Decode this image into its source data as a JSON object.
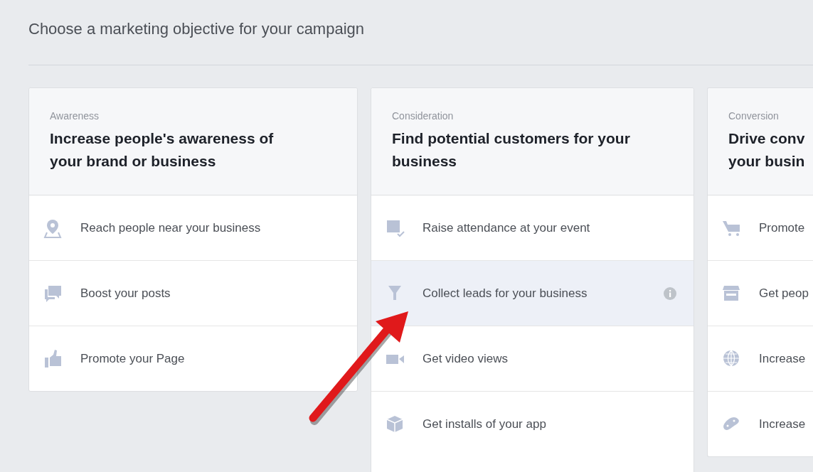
{
  "title": "Choose a marketing objective for your campaign",
  "objectives": [
    {
      "category": "Awareness",
      "heading_lines": [
        "Increase people's awareness of",
        "your brand or business"
      ],
      "options": [
        {
          "label": "Reach people near your business",
          "kind": "pin",
          "selected": false
        },
        {
          "label": "Boost your posts",
          "kind": "chat",
          "selected": false
        },
        {
          "label": "Promote your Page",
          "kind": "thumb",
          "selected": false
        }
      ]
    },
    {
      "category": "Consideration",
      "heading_lines": [
        "Find potential customers for your",
        "business"
      ],
      "options": [
        {
          "label": "Raise attendance at your event",
          "kind": "calendar",
          "selected": false
        },
        {
          "label": "Collect leads for your business",
          "kind": "funnel",
          "selected": true
        },
        {
          "label": "Get video views",
          "kind": "video",
          "selected": false
        },
        {
          "label": "Get installs of your app",
          "kind": "box",
          "selected": false
        }
      ]
    },
    {
      "category": "Conversion",
      "heading_lines": [
        "Drive conv",
        "your busin"
      ],
      "options": [
        {
          "label": "Promote",
          "kind": "cart",
          "selected": false
        },
        {
          "label": "Get peop",
          "kind": "store",
          "selected": false
        },
        {
          "label": "Increase",
          "kind": "globe",
          "selected": false
        },
        {
          "label": "Increase",
          "kind": "gamepad",
          "selected": false
        }
      ]
    }
  ]
}
